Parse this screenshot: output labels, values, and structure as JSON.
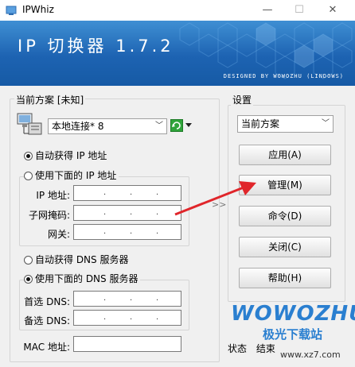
{
  "window": {
    "title": "IPWhiz",
    "minimize": "—",
    "maximize": "☐",
    "close": "✕"
  },
  "banner": {
    "title": "IP 切换器 1.7.2",
    "subtitle": "DESIGNED BY WOWOZHU (LINDOWS)"
  },
  "scheme_group": {
    "label": "当前方案 [未知]",
    "connection": "本地连接* 8",
    "auto_ip_label": "自动获得 IP 地址",
    "manual_ip_label": "使用下面的 IP 地址",
    "ip_label": "IP 地址:",
    "mask_label": "子网掩码:",
    "gateway_label": "网关:",
    "auto_dns_label": "自动获得 DNS 服务器",
    "manual_dns_label": "使用下面的 DNS 服务器",
    "dns1_label": "首选 DNS:",
    "dns2_label": "备选 DNS:",
    "mac_label": "MAC 地址:"
  },
  "settings_group": {
    "label": "设置",
    "scheme_select": "当前方案",
    "apply": "应用(A)",
    "manage": "管理(M)",
    "command": "命令(D)",
    "close": "关闭(C)",
    "help": "帮助(H)"
  },
  "separator": ">>",
  "status": {
    "label": "状态",
    "value": "结束"
  },
  "watermark": {
    "brand": "WOWOZHU",
    "site_name": "极光下载站",
    "site_url": "www.xz7.com"
  },
  "colors": {
    "banner": "#1d63b2",
    "arrow": "#e0262b",
    "watermark": "#2a7fd0"
  }
}
